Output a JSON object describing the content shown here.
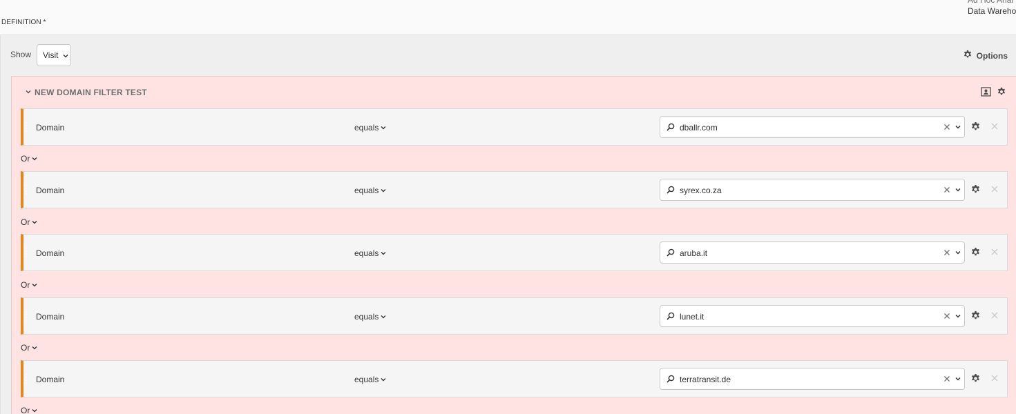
{
  "header": {
    "top_right_line1": "Ad Hoc Anal",
    "top_right_line2": "Data Wareho",
    "definition_label": "DEFINITION *"
  },
  "toolbar": {
    "show_label": "Show",
    "show_value": "Visit",
    "options_label": "Options"
  },
  "container": {
    "title": "NEW DOMAIN FILTER TEST"
  },
  "rules": [
    {
      "dimension": "Domain",
      "operator": "equals",
      "value": "dballr.com"
    },
    {
      "dimension": "Domain",
      "operator": "equals",
      "value": "syrex.co.za"
    },
    {
      "dimension": "Domain",
      "operator": "equals",
      "value": "aruba.it"
    },
    {
      "dimension": "Domain",
      "operator": "equals",
      "value": "lunet.it"
    },
    {
      "dimension": "Domain",
      "operator": "equals",
      "value": "terratransit.de"
    }
  ],
  "connectors": [
    "Or",
    "Or",
    "Or",
    "Or",
    "Or"
  ],
  "icons": {
    "chevron": "chevron-down-icon",
    "gear": "gear-icon",
    "search": "search-icon",
    "clear": "clear-icon",
    "close": "close-icon",
    "segment": "segment-icon"
  },
  "colors": {
    "container_bg": "#ffe3e3",
    "rule_accent": "#e68619",
    "panel_bg": "#efefef"
  }
}
